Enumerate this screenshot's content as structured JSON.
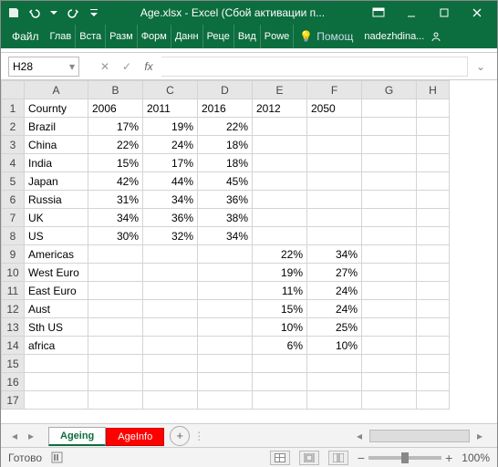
{
  "title": "Age.xlsx - Excel (Сбой активации п...",
  "ribbon": {
    "file": "Файл",
    "tabs": [
      "Глав",
      "Вста",
      "Разм",
      "Форм",
      "Данн",
      "Реце",
      "Вид",
      "Powe"
    ],
    "help": "Помощ",
    "user": "nadezhdina..."
  },
  "namebox": "H28",
  "formula": "",
  "columns": [
    "A",
    "B",
    "C",
    "D",
    "E",
    "F",
    "G",
    "H"
  ],
  "rows": [
    "1",
    "2",
    "3",
    "4",
    "5",
    "6",
    "7",
    "8",
    "9",
    "10",
    "11",
    "12",
    "13",
    "14",
    "15",
    "16",
    "17"
  ],
  "cells": {
    "A1": "Cournty",
    "B1": "2006",
    "C1": "2011",
    "D1": "2016",
    "E1": "2012",
    "F1": "2050",
    "A2": "Brazil",
    "B2": "17%",
    "C2": "19%",
    "D2": "22%",
    "A3": "China",
    "B3": "22%",
    "C3": "24%",
    "D3": "18%",
    "A4": "India",
    "B4": "15%",
    "C4": "17%",
    "D4": "18%",
    "A5": "Japan",
    "B5": "42%",
    "C5": "44%",
    "D5": "45%",
    "A6": "Russia",
    "B6": "31%",
    "C6": "34%",
    "D6": "36%",
    "A7": "UK",
    "B7": "34%",
    "C7": "36%",
    "D7": "38%",
    "A8": "US",
    "B8": "30%",
    "C8": "32%",
    "D8": "34%",
    "A9": "Americas",
    "E9": "22%",
    "F9": "34%",
    "A10": "West Euro",
    "E10": "19%",
    "F10": "27%",
    "A11": "East Euro",
    "E11": "11%",
    "F11": "24%",
    "A12": "Aust",
    "E12": "15%",
    "F12": "24%",
    "A13": "Sth US",
    "E13": "10%",
    "F13": "25%",
    "A14": "africa",
    "E14": "6%",
    "F14": "10%"
  },
  "sheets": {
    "active": "Ageing",
    "other": "AgeInfo"
  },
  "status": {
    "ready": "Готово",
    "zoom": "100%"
  },
  "chart_data": {
    "type": "table",
    "title": "Age.xlsx — Ageing sheet",
    "series": [
      {
        "name": "2006",
        "categories": [
          "Brazil",
          "China",
          "India",
          "Japan",
          "Russia",
          "UK",
          "US"
        ],
        "values": [
          17,
          22,
          15,
          42,
          31,
          34,
          30
        ]
      },
      {
        "name": "2011",
        "categories": [
          "Brazil",
          "China",
          "India",
          "Japan",
          "Russia",
          "UK",
          "US"
        ],
        "values": [
          19,
          24,
          17,
          44,
          34,
          36,
          32
        ]
      },
      {
        "name": "2016",
        "categories": [
          "Brazil",
          "China",
          "India",
          "Japan",
          "Russia",
          "UK",
          "US"
        ],
        "values": [
          22,
          18,
          18,
          45,
          36,
          38,
          34
        ]
      },
      {
        "name": "2012",
        "categories": [
          "Americas",
          "West Euro",
          "East Euro",
          "Aust",
          "Sth US",
          "africa"
        ],
        "values": [
          22,
          19,
          11,
          15,
          10,
          6
        ]
      },
      {
        "name": "2050",
        "categories": [
          "Americas",
          "West Euro",
          "East Euro",
          "Aust",
          "Sth US",
          "africa"
        ],
        "values": [
          34,
          27,
          24,
          24,
          25,
          10
        ]
      }
    ],
    "unit": "%"
  }
}
